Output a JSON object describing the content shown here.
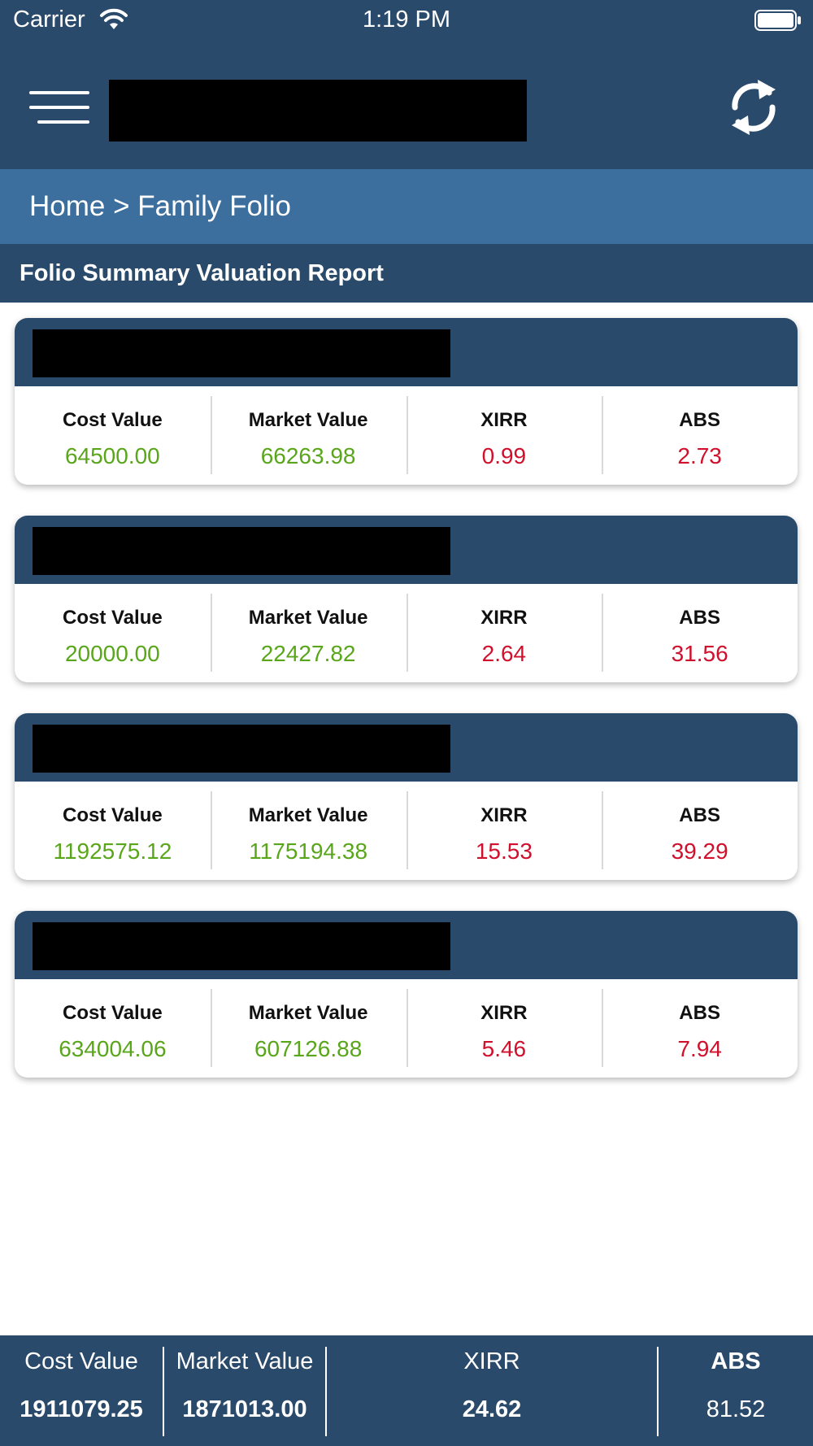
{
  "status_bar": {
    "carrier": "Carrier",
    "time": "1:19 PM"
  },
  "app_bar": {
    "menu_icon": "hamburger-menu-icon",
    "refresh_icon": "refresh-icon"
  },
  "breadcrumb": {
    "home": "Home",
    "separator": ">",
    "current": "Family Folio"
  },
  "report_title": "Folio Summary Valuation Report",
  "column_labels": {
    "cost": "Cost Value",
    "market": "Market Value",
    "xirr": "XIRR",
    "abs": "ABS"
  },
  "folios": [
    {
      "cost_value": "64500.00",
      "market_value": "66263.98",
      "xirr": "0.99",
      "abs": "2.73"
    },
    {
      "cost_value": "20000.00",
      "market_value": "22427.82",
      "xirr": "2.64",
      "abs": "31.56"
    },
    {
      "cost_value": "1192575.12",
      "market_value": "1175194.38",
      "xirr": "15.53",
      "abs": "39.29"
    },
    {
      "cost_value": "634004.06",
      "market_value": "607126.88",
      "xirr": "5.46",
      "abs": "7.94"
    }
  ],
  "totals": {
    "cost_label": "Cost Value",
    "cost_value": "1911079.25",
    "market_label": "Market Value",
    "market_value": "1871013.00",
    "xirr_label": "XIRR",
    "xirr_value": "24.62",
    "abs_label": "ABS",
    "abs_value": "81.52"
  },
  "colors": {
    "header_navy": "#2a4a6b",
    "breadcrumb_blue": "#3d6f9e",
    "positive_green": "#5aa61b",
    "return_red": "#d0102c"
  }
}
